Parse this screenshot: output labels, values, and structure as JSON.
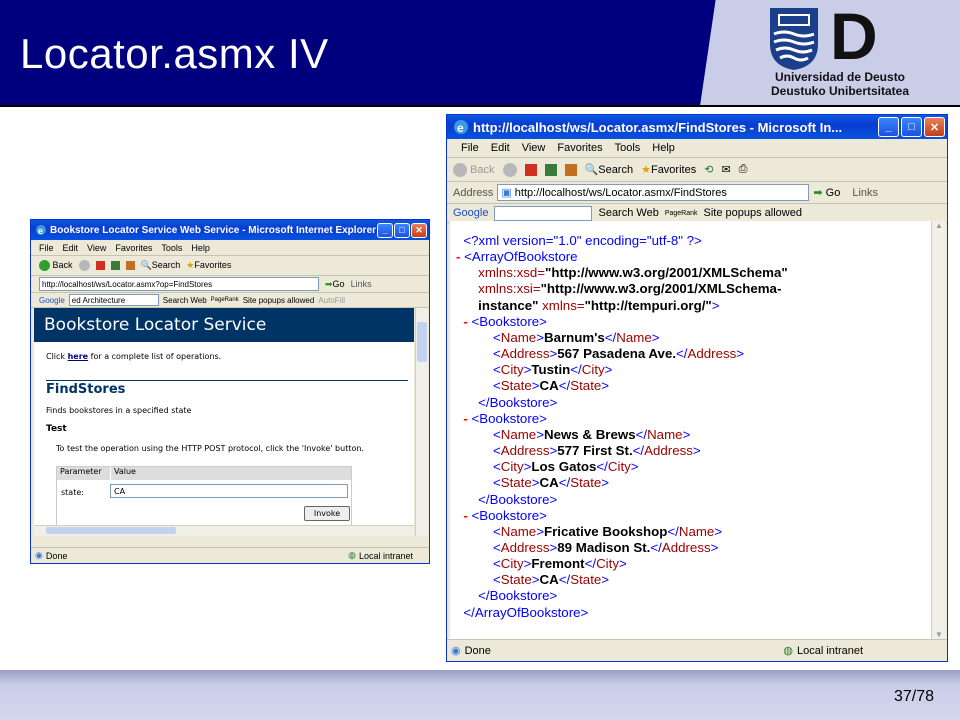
{
  "slide": {
    "title": "Locator.asmx IV",
    "page_number": "37/78",
    "logo_letter": "D",
    "logo_line1": "Universidad de Deusto",
    "logo_line2": "Deustuko Unibertsitatea"
  },
  "left_window": {
    "title": "Bookstore Locator Service Web Service - Microsoft Internet Explorer",
    "menu": [
      "File",
      "Edit",
      "View",
      "Favorites",
      "Tools",
      "Help"
    ],
    "back_label": "Back",
    "search_label": "Search",
    "favorites_label": "Favorites",
    "address": "http://localhost/ws/Locator.asmx?op=FindStores",
    "go_label": "Go",
    "links_label": "Links",
    "google_label": "Google",
    "google_field": "ed Architecture",
    "search_web_label": "Search Web",
    "pagerank_label": "PageRank",
    "popups_label": "Site popups allowed",
    "autofill_label": "AutoFill",
    "status_done": "Done",
    "status_zone": "Local intranet",
    "page": {
      "banner": "Bookstore Locator Service",
      "click_prefix": "Click ",
      "click_link": "here",
      "click_suffix": " for a complete list of operations.",
      "op_title": "FindStores",
      "op_desc": "Finds bookstores in a specified state",
      "test_heading": "Test",
      "test_desc": "To test the operation using the HTTP POST protocol, click the 'Invoke' button.",
      "col_parameter": "Parameter",
      "col_value": "Value",
      "param_name": "state:",
      "param_value": "CA",
      "invoke_label": "Invoke"
    }
  },
  "right_window": {
    "title": "http://localhost/ws/Locator.asmx/FindStores - Microsoft In...",
    "menu": [
      "File",
      "Edit",
      "View",
      "Favorites",
      "Tools",
      "Help"
    ],
    "back_label": "Back",
    "search_label": "Search",
    "favorites_label": "Favorites",
    "address_label": "Address",
    "address": "http://localhost/ws/Locator.asmx/FindStores",
    "go_label": "Go",
    "links_label": "Links",
    "google_label": "Google",
    "search_web_label": "Search Web",
    "pagerank_label": "PageRank",
    "popups_label": "Site popups allowed",
    "status_done": "Done",
    "status_zone": "Local intranet",
    "xml": {
      "decl": "<?xml version=\"1.0\" encoding=\"utf-8\" ?>",
      "root_open": "<ArrayOfBookstore",
      "ns1_attr": "xmlns:xsd=",
      "ns1_val": "\"http://www.w3.org/2001/XMLSchema\"",
      "ns2_attr": "xmlns:xsi=",
      "ns2_val_a": "\"http://www.w3.org/2001/XMLSchema-",
      "ns2_val_b": "instance\"",
      "ns3_attr": " xmlns=",
      "ns3_val": "\"http://tempuri.org/\"",
      "ns3_close": ">",
      "root_close": "</ArrayOfBookstore>",
      "book_open": "<Bookstore>",
      "book_close": "</Bookstore>",
      "bookstores": [
        {
          "name": "Barnum's",
          "address": "567 Pasadena Ave.",
          "city": "Tustin",
          "state": "CA"
        },
        {
          "name": "News & Brews",
          "address": "577 First St.",
          "city": "Los Gatos",
          "state": "CA"
        },
        {
          "name": "Fricative Bookshop",
          "address": "89 Madison St.",
          "city": "Fremont",
          "state": "CA"
        }
      ]
    }
  }
}
